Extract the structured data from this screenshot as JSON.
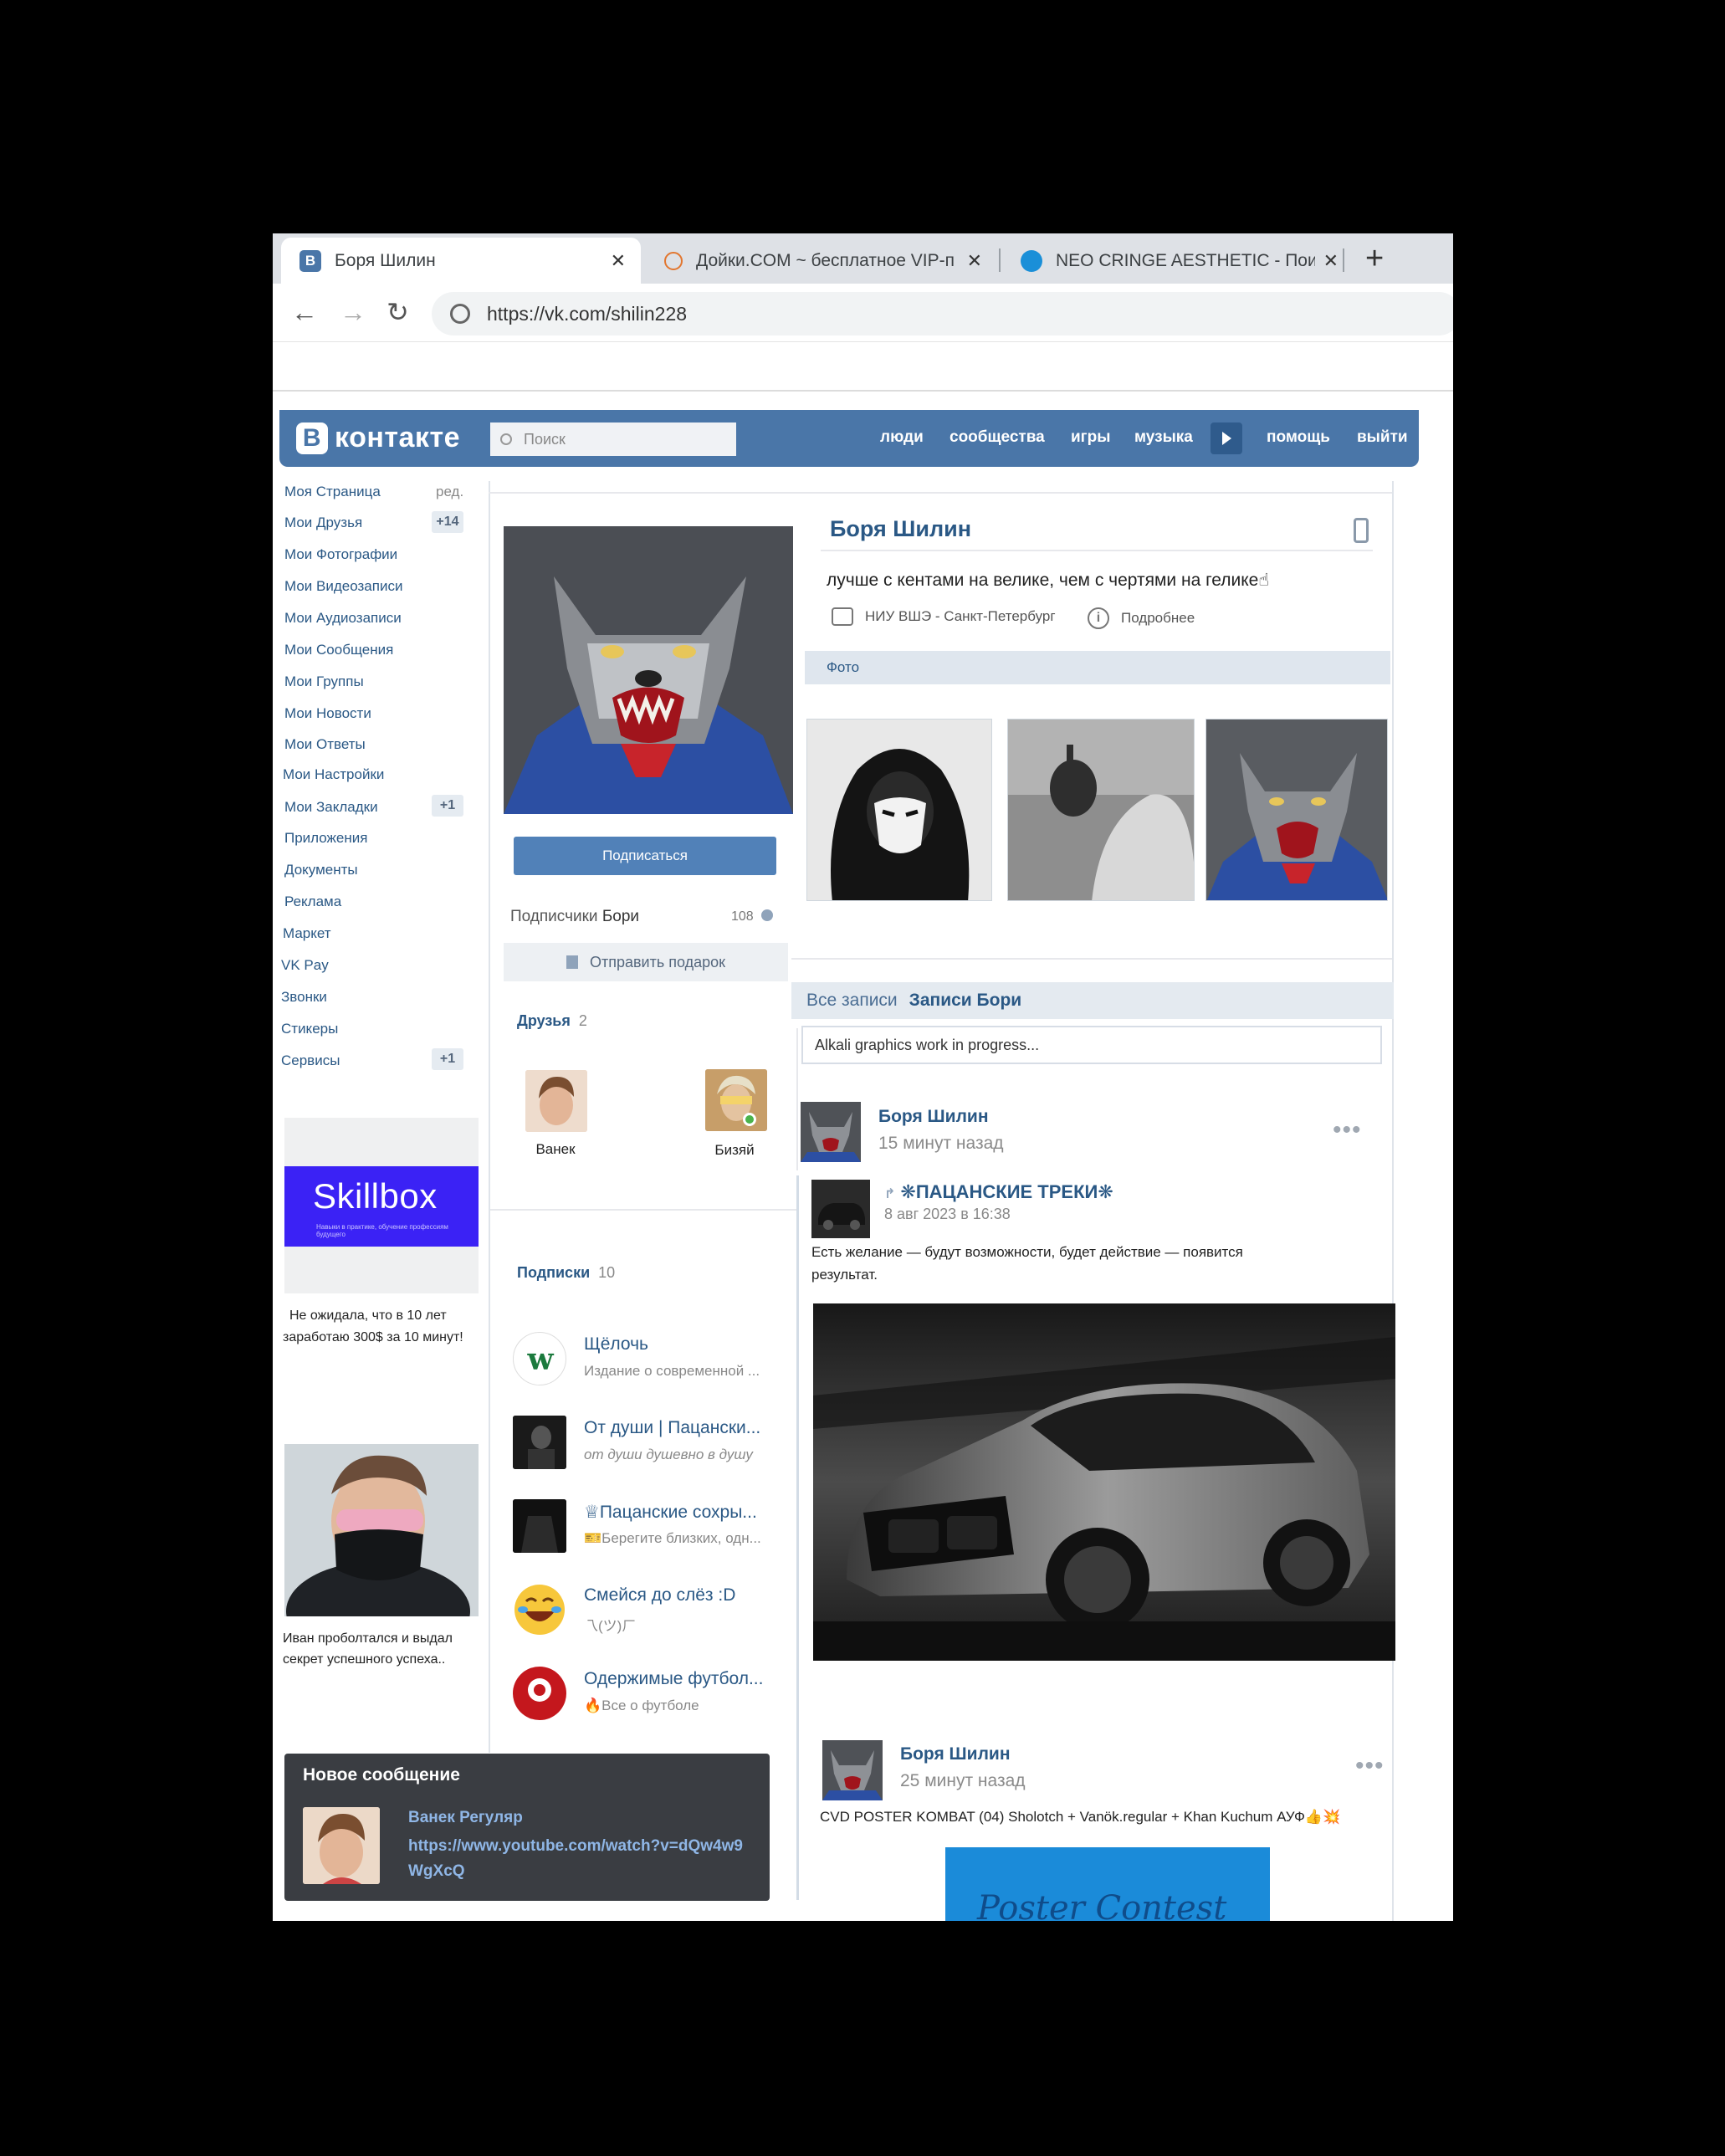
{
  "browser": {
    "tabs": [
      {
        "title": "Боря Шилин",
        "favicon": "vk-icon"
      },
      {
        "title": "Дойки.COM ~ бесплатное VIP-п",
        "favicon": "site-icon"
      },
      {
        "title": "NEO CRINGE AESTHETIC - Поиск",
        "favicon": "ie-icon"
      }
    ],
    "close_glyph": "✕",
    "new_tab_glyph": "+",
    "url": "https://vk.com/shilin228"
  },
  "vk": {
    "logo_letter": "В",
    "logo_text": "контакте",
    "search_placeholder": "Поиск",
    "nav": [
      "люди",
      "сообщества",
      "игры",
      "музыка",
      "помощь",
      "выйти"
    ],
    "accent": "#4a76a8"
  },
  "left_menu": {
    "edit": "ред.",
    "items": [
      {
        "label": "Моя Страница"
      },
      {
        "label": "Мои Друзья",
        "badge": "+14"
      },
      {
        "label": "Мои Фотографии"
      },
      {
        "label": "Мои Видеозаписи"
      },
      {
        "label": "Мои Аудиозаписи"
      },
      {
        "label": "Мои Сообщения"
      },
      {
        "label": "Мои Группы"
      },
      {
        "label": "Мои Новости"
      },
      {
        "label": "Мои Ответы"
      },
      {
        "label": "Мои Настройки"
      },
      {
        "label": "Мои Закладки",
        "badge": "+1"
      },
      {
        "label": "Приложения"
      },
      {
        "label": "Документы"
      },
      {
        "label": "Реклама"
      },
      {
        "label": "Маркет"
      },
      {
        "label": "VK Pay"
      },
      {
        "label": "Звонки"
      },
      {
        "label": "Стикеры"
      },
      {
        "label": "Сервисы",
        "badge": "+1"
      }
    ]
  },
  "ads": [
    {
      "brand": "Skillbox",
      "tagline": "Навыки в практике, обучение профессиям будущего",
      "text_lines": [
        "Не ожидала, что в 10 лет",
        "заработаю 300$ за 10 минут!"
      ]
    },
    {
      "text_lines": [
        "Иван проболтался и выдал",
        "секрет успешного успеха.."
      ]
    }
  ],
  "profile": {
    "name": "Боря Шилин",
    "status": "лучше с кентами на велике, чем с чертями на гелике☝",
    "university": "НИУ ВШЭ - Санкт-Петербург",
    "more": "Подробнее",
    "subscribe_button": "Подписаться",
    "followers_label": "Подписчики",
    "followers_owner": "Бори",
    "followers_count": "108",
    "gift_button": "Отправить подарок",
    "photos_label": "Фото"
  },
  "friends": {
    "title": "Друзья",
    "count": "2",
    "items": [
      {
        "name": "Ванек"
      },
      {
        "name": "Бизяй"
      }
    ]
  },
  "subscriptions": {
    "title": "Подписки",
    "count": "10",
    "items": [
      {
        "name": "Щёлочь",
        "desc": "Издание о современной ..."
      },
      {
        "name": "От души | Пацански...",
        "desc": "от души душевно в душу"
      },
      {
        "name": "♕Пацанские сохры...",
        "desc": "🎫Берегите близких, одн..."
      },
      {
        "name": "Смейся до слёз :D",
        "desc": "乁(ツ)ㄏ"
      },
      {
        "name": "Одержимые футбол...",
        "desc": "🔥Все о футболе"
      }
    ]
  },
  "wall": {
    "tab_all": "Все записи",
    "tab_owner": "Записи Бори",
    "input_value": "Alkali graphics work in progress...",
    "posts": [
      {
        "author": "Боря Шилин",
        "time": "15 минут назад",
        "repost": {
          "source": "❋ПАЦАНСКИЕ ТРЕКИ❋",
          "date": "8 авг 2023 в 16:38",
          "text": "Есть желание — будут возможности, будет действие — появится результат."
        }
      },
      {
        "author": "Боря Шилин",
        "time": "25 минут назад",
        "text": "CVD POSTER KOMBAT (04)   Sholotch + Vanök.regular + Khan Kuchum   АУФ👍💥",
        "poster_text": "Poster Contest"
      }
    ],
    "more_glyph": "•••"
  },
  "message_popup": {
    "title": "Новое сообщение",
    "sender": "Ванек Регуляр",
    "text": "https://www.youtube.com/watch?v=dQw4w9WgXcQ"
  }
}
